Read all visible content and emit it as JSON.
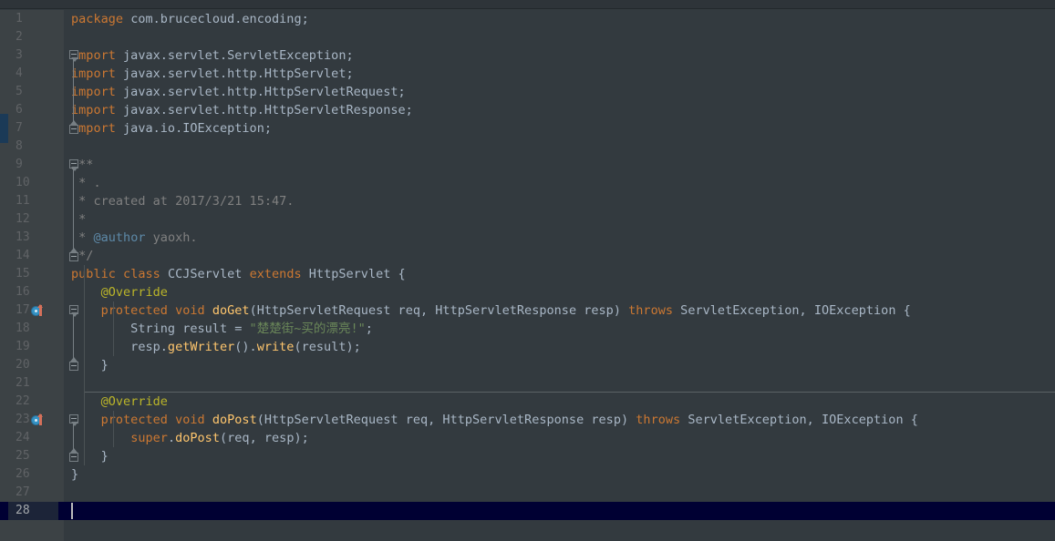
{
  "editor": {
    "theme": "darcula",
    "language": "java",
    "colors": {
      "background": "#333a3f",
      "gutter_background": "#3c4245",
      "line_number": "#606366",
      "caret_line": "#000033",
      "keyword": "#cc7832",
      "string": "#6a8759",
      "comment": "#808080",
      "method": "#ffc66d",
      "annotation": "#bbb529",
      "default_text": "#a9b7c6",
      "javadoc_tag": "#5d89a8",
      "vcs_marker": "#1b3a57"
    },
    "caret": {
      "line": 28,
      "column": 1
    },
    "lines": [
      {
        "n": 1,
        "tokens": [
          {
            "t": "package",
            "c": "kw2"
          },
          {
            "t": " com.brucecloud.encoding;",
            "c": "plain"
          }
        ]
      },
      {
        "n": 2,
        "tokens": []
      },
      {
        "n": 3,
        "fold": "open",
        "tokens": [
          {
            "t": "import",
            "c": "kw2"
          },
          {
            "t": " javax.servlet.ServletException;",
            "c": "plain"
          }
        ]
      },
      {
        "n": 4,
        "tokens": [
          {
            "t": "import",
            "c": "kw2"
          },
          {
            "t": " javax.servlet.http.HttpServlet;",
            "c": "plain"
          }
        ]
      },
      {
        "n": 5,
        "tokens": [
          {
            "t": "import",
            "c": "kw2"
          },
          {
            "t": " javax.servlet.http.HttpServletRequest;",
            "c": "plain"
          }
        ]
      },
      {
        "n": 6,
        "tokens": [
          {
            "t": "import",
            "c": "kw2"
          },
          {
            "t": " javax.servlet.http.HttpServletResponse;",
            "c": "plain"
          }
        ]
      },
      {
        "n": 7,
        "fold": "close",
        "tokens": [
          {
            "t": "import",
            "c": "kw2"
          },
          {
            "t": " java.io.IOException;",
            "c": "plain"
          }
        ]
      },
      {
        "n": 8,
        "tokens": []
      },
      {
        "n": 9,
        "fold": "open",
        "tokens": [
          {
            "t": "/**",
            "c": "cmt"
          }
        ]
      },
      {
        "n": 10,
        "tokens": [
          {
            "t": " * .",
            "c": "cmt"
          }
        ]
      },
      {
        "n": 11,
        "tokens": [
          {
            "t": " * created at 2017/3/21 15:47.",
            "c": "cmt"
          }
        ]
      },
      {
        "n": 12,
        "tokens": [
          {
            "t": " *",
            "c": "cmt"
          }
        ]
      },
      {
        "n": 13,
        "tokens": [
          {
            "t": " * ",
            "c": "cmt"
          },
          {
            "t": "@author",
            "c": "author-tag"
          },
          {
            "t": " yaoxh.",
            "c": "cmt"
          }
        ]
      },
      {
        "n": 14,
        "fold": "close",
        "tokens": [
          {
            "t": " */",
            "c": "cmt"
          }
        ]
      },
      {
        "n": 15,
        "tokens": [
          {
            "t": "public",
            "c": "kw"
          },
          {
            "t": " ",
            "c": "plain"
          },
          {
            "t": "class",
            "c": "kw"
          },
          {
            "t": " CCJServlet ",
            "c": "plain"
          },
          {
            "t": "extends",
            "c": "kw"
          },
          {
            "t": " HttpServlet {",
            "c": "plain"
          }
        ]
      },
      {
        "n": 16,
        "tokens": [
          {
            "t": "    @Override",
            "c": "anno"
          }
        ]
      },
      {
        "n": 17,
        "fold": "open",
        "override_icon": true,
        "tokens": [
          {
            "t": "    ",
            "c": "plain"
          },
          {
            "t": "protected",
            "c": "kw"
          },
          {
            "t": " ",
            "c": "plain"
          },
          {
            "t": "void",
            "c": "kw"
          },
          {
            "t": " ",
            "c": "plain"
          },
          {
            "t": "doGet",
            "c": "meth"
          },
          {
            "t": "(HttpServletRequest req, HttpServletResponse resp) ",
            "c": "plain"
          },
          {
            "t": "throws",
            "c": "kw"
          },
          {
            "t": " ServletException, IOException {",
            "c": "plain"
          }
        ]
      },
      {
        "n": 18,
        "tokens": [
          {
            "t": "        String result = ",
            "c": "plain"
          },
          {
            "t": "\"楚楚街~买的漂亮!\"",
            "c": "str"
          },
          {
            "t": ";",
            "c": "plain"
          }
        ]
      },
      {
        "n": 19,
        "tokens": [
          {
            "t": "        resp.",
            "c": "plain"
          },
          {
            "t": "getWriter",
            "c": "meth"
          },
          {
            "t": "().",
            "c": "plain"
          },
          {
            "t": "write",
            "c": "meth"
          },
          {
            "t": "(result);",
            "c": "plain"
          }
        ]
      },
      {
        "n": 20,
        "fold": "close",
        "tokens": [
          {
            "t": "    }",
            "c": "plain"
          }
        ]
      },
      {
        "n": 21,
        "tokens": []
      },
      {
        "n": 22,
        "separator_above": true,
        "tokens": [
          {
            "t": "    @Override",
            "c": "anno"
          }
        ]
      },
      {
        "n": 23,
        "fold": "open",
        "override_icon": true,
        "tokens": [
          {
            "t": "    ",
            "c": "plain"
          },
          {
            "t": "protected",
            "c": "kw"
          },
          {
            "t": " ",
            "c": "plain"
          },
          {
            "t": "void",
            "c": "kw"
          },
          {
            "t": " ",
            "c": "plain"
          },
          {
            "t": "doPost",
            "c": "meth"
          },
          {
            "t": "(HttpServletRequest req, HttpServletResponse resp) ",
            "c": "plain"
          },
          {
            "t": "throws",
            "c": "kw"
          },
          {
            "t": " ServletException, IOException {",
            "c": "plain"
          }
        ]
      },
      {
        "n": 24,
        "tokens": [
          {
            "t": "        ",
            "c": "plain"
          },
          {
            "t": "super",
            "c": "kw"
          },
          {
            "t": ".",
            "c": "plain"
          },
          {
            "t": "doPost",
            "c": "meth"
          },
          {
            "t": "(req, resp);",
            "c": "plain"
          }
        ]
      },
      {
        "n": 25,
        "fold": "close",
        "tokens": [
          {
            "t": "    }",
            "c": "plain"
          }
        ]
      },
      {
        "n": 26,
        "tokens": [
          {
            "t": "}",
            "c": "plain"
          }
        ]
      },
      {
        "n": 27,
        "tokens": []
      },
      {
        "n": 28,
        "caret": true,
        "tokens": []
      }
    ]
  }
}
